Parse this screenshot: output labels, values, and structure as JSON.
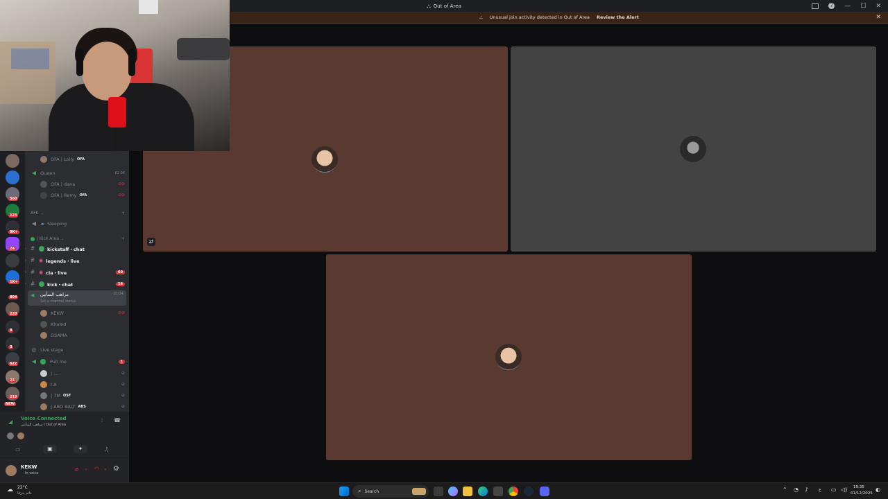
{
  "window": {
    "title": "Out of Area",
    "controls": [
      "—",
      "☐",
      "✕"
    ]
  },
  "alert": {
    "message": "Unusual join activity detected in Out of Area",
    "action": "Review the Alert"
  },
  "rail_badges": [
    "560",
    "123",
    "9K+",
    "24",
    "1K+",
    "804",
    "229",
    "8",
    "3",
    "622",
    "23",
    "219",
    "NEW"
  ],
  "channels": {
    "top_user": {
      "name": "OFA | Lolly",
      "tag": "OFA"
    },
    "queen": {
      "name": "Queen",
      "counter_a": "02",
      "counter_b": "04"
    },
    "queen_users": [
      {
        "name": "OFA | dana"
      },
      {
        "name": "OFA | Remy",
        "tag": "OFA"
      }
    ],
    "afk_category": "AFK",
    "sleeping": "Sleeping",
    "kick_category": "| Kick Area",
    "text_channels": [
      {
        "name": "kickstaff・chat",
        "badge": ""
      },
      {
        "name": "legends・live",
        "badge": ""
      },
      {
        "name": "cia・live",
        "badge": "60"
      },
      {
        "name": "kick・chat",
        "badge": "14"
      }
    ],
    "voice_active": {
      "name": "مراهب المتأنين",
      "count": "22/24",
      "status": "Set a channel status"
    },
    "voice_users": [
      {
        "name": "KEKW"
      },
      {
        "name": "Khaled"
      },
      {
        "name": "OSAMA"
      }
    ],
    "live_stage": "Live stage",
    "pull_me": {
      "name": "Pull me",
      "badge": "1"
    },
    "stage_users": [
      {
        "name": "| ...",
        "tag": ""
      },
      {
        "name": "I A",
        "tag": ""
      },
      {
        "name": "| 7M",
        "tag": "OSF"
      },
      {
        "name": "| ABO 9ALT",
        "tag": "ABS"
      }
    ]
  },
  "voice": {
    "status": "Voice Connected",
    "location": "مراهب المتأنين / Out of Area"
  },
  "user": {
    "name": "KEKW",
    "status": "In voice"
  },
  "taskbar": {
    "weather_temp": "22°C",
    "weather_text": "غائم جزئيًا",
    "search_placeholder": "Search",
    "time": "19:35",
    "date": "01/12/2025",
    "lang": "ع"
  },
  "colors": {
    "tile_brown": "#5a3a30",
    "tile_gray": "#434343",
    "green": "#3ba55c",
    "red": "#da373c"
  }
}
